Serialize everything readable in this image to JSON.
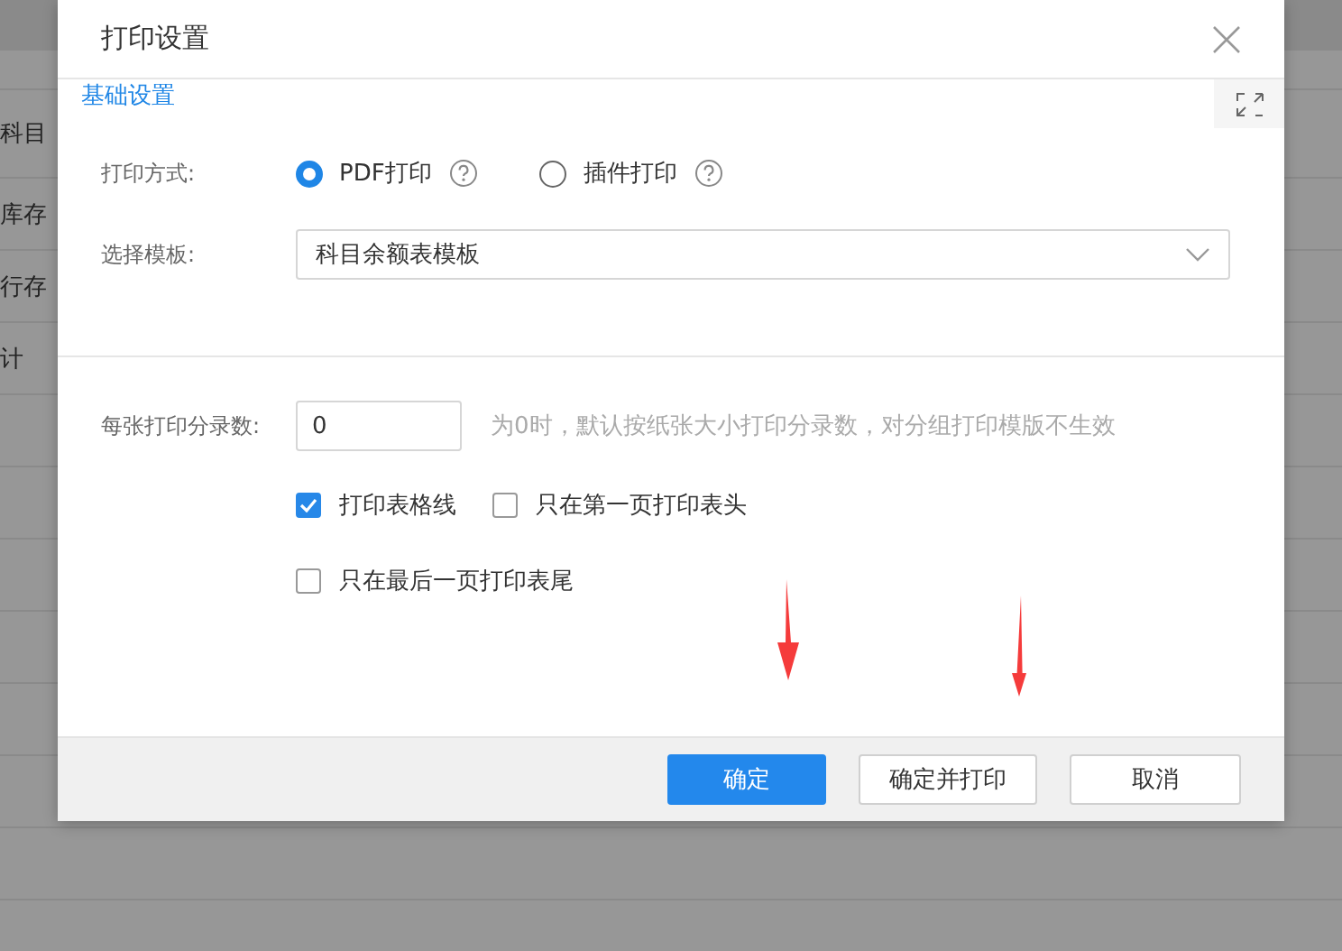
{
  "background": {
    "rows": [
      {
        "text": "科目"
      },
      {
        "text": "库存"
      },
      {
        "text": "行存"
      },
      {
        "text": "计"
      }
    ]
  },
  "dialog": {
    "title": "打印设置",
    "tabs": [
      {
        "label": "基础设置",
        "selected": true
      }
    ],
    "print_method": {
      "label": "打印方式:",
      "options": [
        {
          "label": "PDF打印",
          "selected": true
        },
        {
          "label": "插件打印",
          "selected": false
        }
      ]
    },
    "template": {
      "label": "选择模板:",
      "value": "科目余额表模板"
    },
    "entries_per_page": {
      "label": "每张打印分录数:",
      "value": "0",
      "hint": "为0时，默认按纸张大小打印分录数，对分组打印模版不生效"
    },
    "checkboxes": [
      {
        "label": "打印表格线",
        "checked": true
      },
      {
        "label": "只在第一页打印表头",
        "checked": false
      },
      {
        "label": "只在最后一页打印表尾",
        "checked": false
      }
    ],
    "buttons": [
      {
        "label": "确定",
        "kind": "primary"
      },
      {
        "label": "确定并打印",
        "kind": "default"
      },
      {
        "label": "取消",
        "kind": "default"
      }
    ]
  }
}
